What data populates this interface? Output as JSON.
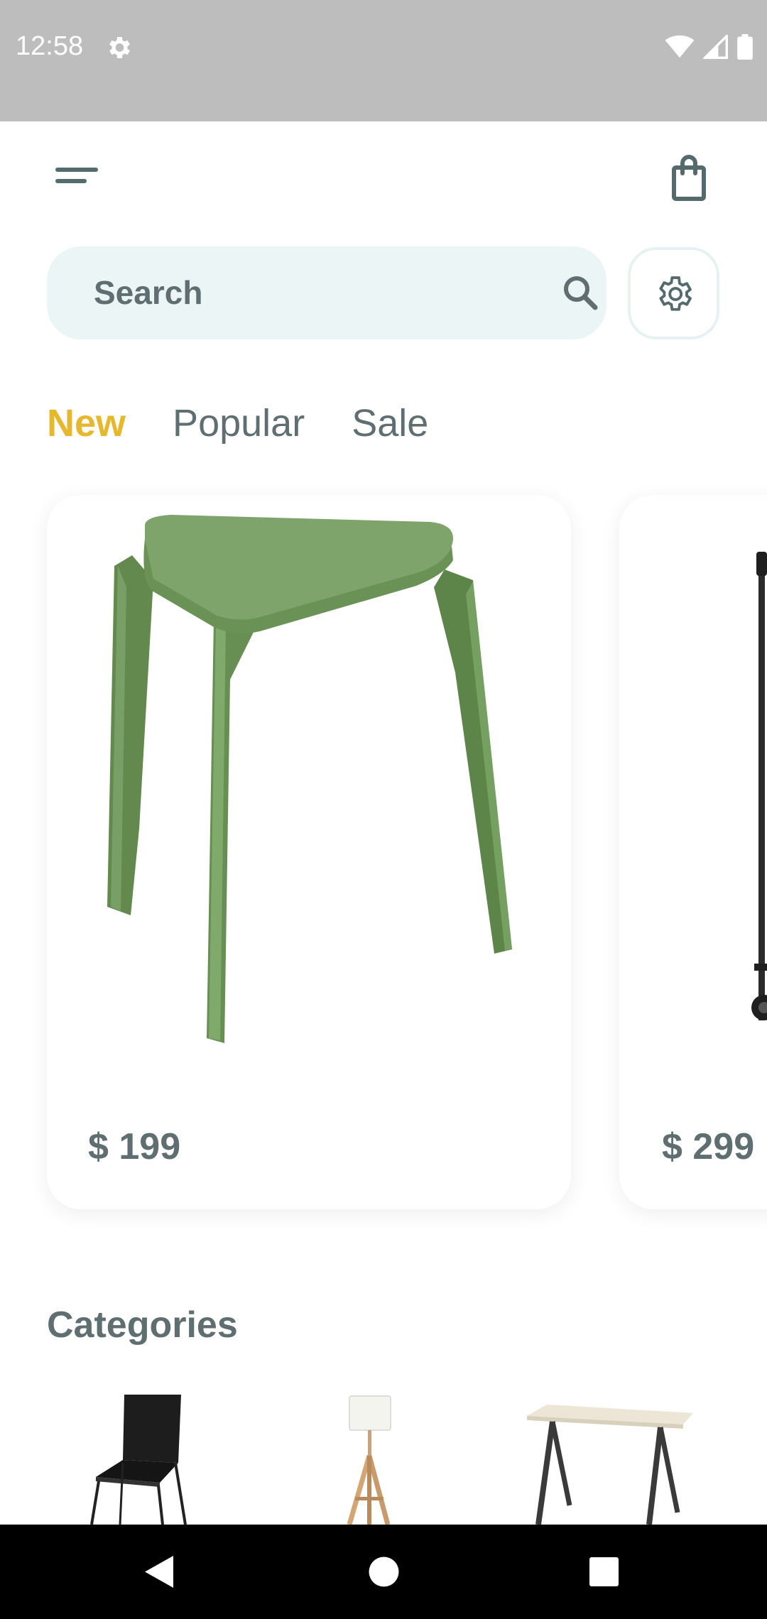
{
  "status_bar": {
    "time": "12:58",
    "icons": [
      "settings-icon",
      "wifi-icon",
      "signal-icon",
      "battery-icon"
    ]
  },
  "app_bar": {
    "menu_icon": "menu-icon",
    "cart_icon": "shopping-bag-icon"
  },
  "search": {
    "placeholder": "Search",
    "icon": "search-icon",
    "filter_icon": "gear-icon"
  },
  "tabs": [
    {
      "label": "New",
      "active": true
    },
    {
      "label": "Popular",
      "active": false
    },
    {
      "label": "Sale",
      "active": false
    }
  ],
  "products": [
    {
      "price": "$ 199",
      "image": "green-stool"
    },
    {
      "price": "$ 299",
      "image": "black-clothes-rack"
    }
  ],
  "categories": {
    "title": "Categories",
    "items": [
      "black-chair",
      "tripod-floor-lamp",
      "desk-table"
    ]
  },
  "colors": {
    "accent": "#e6b82e",
    "text": "#5f6e70",
    "search_bg": "#ebf5f5",
    "status_bar": "#bdbdbd"
  },
  "nav_bar": {
    "buttons": [
      "back-icon",
      "home-icon",
      "recents-icon"
    ]
  }
}
